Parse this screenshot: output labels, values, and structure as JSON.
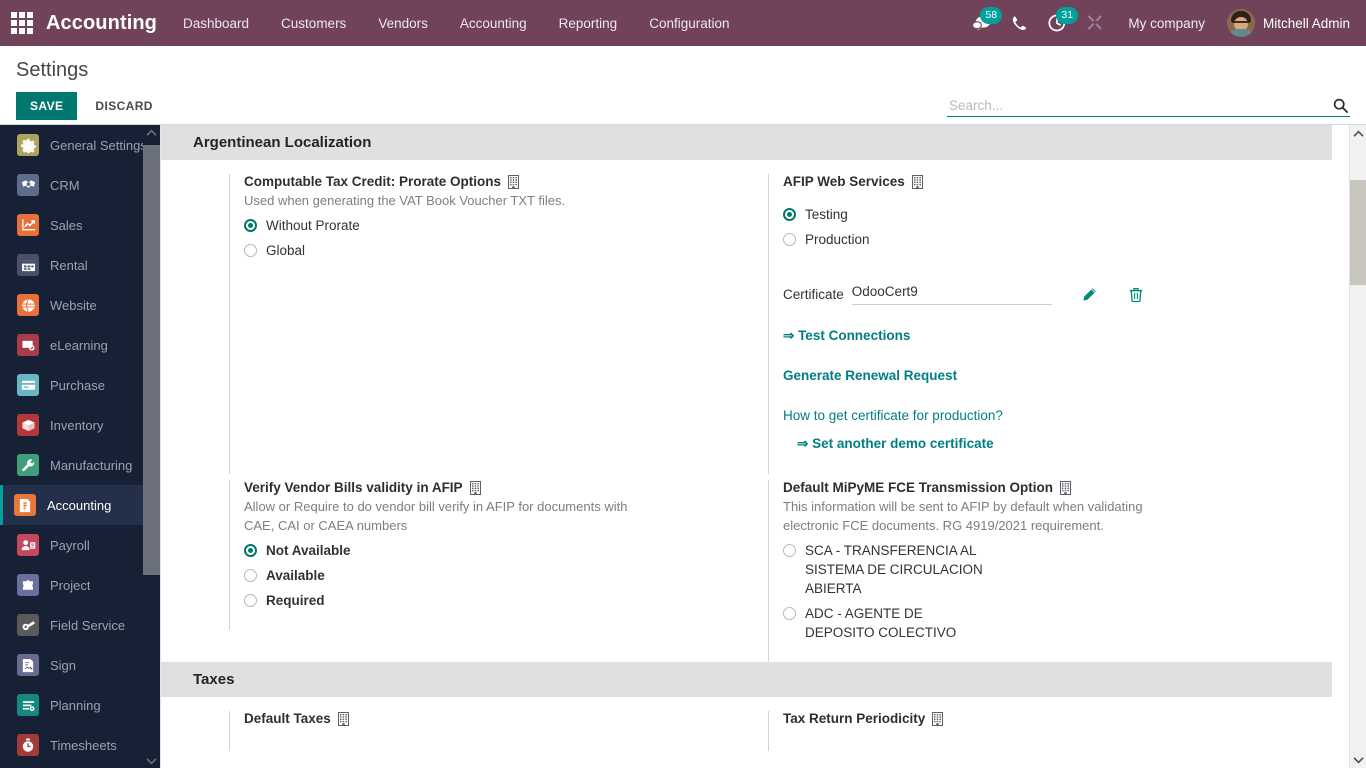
{
  "navbar": {
    "apps_icon": "apps-grid-icon",
    "brand": "Accounting",
    "menu": [
      {
        "label": "Dashboard"
      },
      {
        "label": "Customers"
      },
      {
        "label": "Vendors"
      },
      {
        "label": "Accounting"
      },
      {
        "label": "Reporting"
      },
      {
        "label": "Configuration"
      }
    ],
    "messages_icon": "messages-icon",
    "messages_count": "58",
    "phone_icon": "phone-icon",
    "activities_icon": "activities-clock-icon",
    "activities_count": "31",
    "debug_icon": "debug-wrench-icon",
    "company": "My company",
    "user": "Mitchell Admin",
    "accent": "#71435b"
  },
  "control_panel": {
    "title": "Settings",
    "save_label": "SAVE",
    "discard_label": "DISCARD",
    "save_color": "#00786F",
    "search_placeholder": "Search...",
    "search_value": "",
    "search_icon": "search-icon"
  },
  "sidebar": {
    "items": [
      {
        "label": "General Settings",
        "icon": "gear-icon",
        "color": "#b0a260",
        "active": false
      },
      {
        "label": "CRM",
        "icon": "handshake-icon",
        "color": "#5f6d8c",
        "active": false
      },
      {
        "label": "Sales",
        "icon": "chart-up-icon",
        "color": "#e8703a",
        "active": false
      },
      {
        "label": "Rental",
        "icon": "calendar-icon",
        "color": "#49506b",
        "active": false
      },
      {
        "label": "Website",
        "icon": "globe-icon",
        "color": "#e8703a",
        "active": false
      },
      {
        "label": "eLearning",
        "icon": "presentation-icon",
        "color": "#a83c4a",
        "active": false
      },
      {
        "label": "Purchase",
        "icon": "card-icon",
        "color": "#6bb6c4",
        "active": false
      },
      {
        "label": "Inventory",
        "icon": "box-icon",
        "color": "#b3373b",
        "active": false
      },
      {
        "label": "Manufacturing",
        "icon": "wrench-icon",
        "color": "#3f9e7c",
        "active": false
      },
      {
        "label": "Accounting",
        "icon": "invoice-icon",
        "color": "#e8773c",
        "active": true
      },
      {
        "label": "Payroll",
        "icon": "person-card-icon",
        "color": "#c4495f",
        "active": false
      },
      {
        "label": "Project",
        "icon": "puzzle-icon",
        "color": "#6a6f9e",
        "active": false
      },
      {
        "label": "Field Service",
        "icon": "tools-icon",
        "color": "#5a5a5a",
        "active": false
      },
      {
        "label": "Sign",
        "icon": "signature-icon",
        "color": "#6a6b93",
        "active": false
      },
      {
        "label": "Planning",
        "icon": "planning-icon",
        "color": "#15897f",
        "active": false
      },
      {
        "label": "Timesheets",
        "icon": "stopwatch-icon",
        "color": "#a33a3a",
        "active": false
      }
    ],
    "scroll_up_icon": "chevron-up-icon",
    "scroll_down_icon": "chevron-down-icon"
  },
  "main": {
    "sections": [
      {
        "id": "argentinean",
        "title": "Argentinean Localization"
      },
      {
        "id": "taxes",
        "title": "Taxes"
      }
    ],
    "company_icon_tooltip": "company-specific-icon",
    "prorate": {
      "title": "Computable Tax Credit: Prorate Options",
      "help": "Used when generating the VAT Book Voucher TXT files.",
      "options": [
        {
          "label": "Without Prorate",
          "checked": true
        },
        {
          "label": "Global",
          "checked": false
        }
      ]
    },
    "afip_web_services": {
      "title": "AFIP Web Services",
      "options": [
        {
          "label": "Testing",
          "checked": true
        },
        {
          "label": "Production",
          "checked": false
        }
      ],
      "certificate_label": "Certificate",
      "certificate_value": "OdooCert9",
      "edit_icon": "pencil-icon",
      "delete_icon": "trash-icon",
      "links": [
        {
          "label": "Test Connections",
          "arrow": true,
          "bold": true
        },
        {
          "label": "Generate Renewal Request",
          "arrow": false,
          "bold": true
        },
        {
          "label": "How to get certificate for production?",
          "arrow": false,
          "bold": false
        },
        {
          "label": "Set another demo certificate",
          "arrow": true,
          "bold": true,
          "indent": true
        }
      ]
    },
    "verify_vendor_bills": {
      "title": "Verify Vendor Bills validity in AFIP",
      "help": "Allow or Require to do vendor bill verify in AFIP for documents with CAE, CAI or CAEA numbers",
      "options": [
        {
          "label": "Not Available",
          "checked": true
        },
        {
          "label": "Available",
          "checked": false
        },
        {
          "label": "Required",
          "checked": false
        }
      ]
    },
    "mipyme_fce": {
      "title": "Default MiPyME FCE Transmission Option",
      "help": "This information will be sent to AFIP by default when validating electronic FCE documents. RG 4919/2021 requirement.",
      "options": [
        {
          "label": "SCA - TRANSFERENCIA AL SISTEMA DE CIRCULACION ABIERTA",
          "checked": false
        },
        {
          "label": "ADC - AGENTE DE DEPOSITO COLECTIVO",
          "checked": false
        }
      ]
    },
    "taxes": {
      "default_taxes_title": "Default Taxes",
      "tax_return_periodicity_title": "Tax Return Periodicity"
    },
    "scroll_up_icon": "chevron-up-icon",
    "scroll_down_icon": "chevron-down-icon"
  }
}
